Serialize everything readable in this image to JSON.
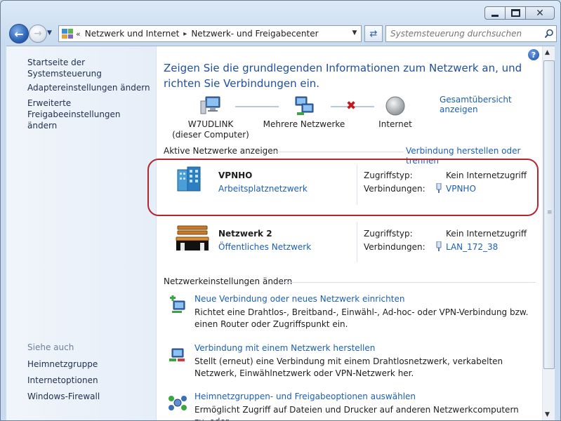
{
  "breadcrumb": {
    "chevrons": "«",
    "items": [
      "Netzwerk und Internet",
      "Netzwerk- und Freigabecenter"
    ]
  },
  "search": {
    "placeholder": "Systemsteuerung durchsuchen"
  },
  "sidebar": {
    "links": [
      "Startseite der Systemsteuerung",
      "Adaptereinstellungen ändern",
      "Erweiterte Freigabeeinstellungen ändern"
    ],
    "see_also_heading": "Siehe auch",
    "see_also": [
      "Heimnetzgruppe",
      "Internetoptionen",
      "Windows-Firewall"
    ]
  },
  "main": {
    "title": "Zeigen Sie die grundlegenden Informationen zum Netzwerk an, und richten Sie Verbindungen ein.",
    "overview_link": "Gesamtübersicht anzeigen",
    "map": {
      "computer_name": "W7UDLINK",
      "computer_sub": "(dieser Computer)",
      "networks_label": "Mehrere Netzwerke",
      "internet_label": "Internet"
    },
    "active_networks": {
      "heading": "Aktive Netzwerke anzeigen",
      "connect_link": "Verbindung herstellen oder trennen",
      "access_type_label": "Zugriffstyp:",
      "connections_label": "Verbindungen:",
      "networks": [
        {
          "name": "VPNHO",
          "category": "Arbeitsplatznetzwerk",
          "access_type": "Kein Internetzugriff",
          "connection": "VPNHO"
        },
        {
          "name": "Netzwerk  2",
          "category": "Öffentliches Netzwerk",
          "access_type": "Kein Internetzugriff",
          "connection": "LAN_172_38"
        }
      ]
    },
    "settings": {
      "heading": "Netzwerkeinstellungen ändern",
      "tasks": [
        {
          "link": "Neue Verbindung oder neues Netzwerk einrichten",
          "desc": "Richtet eine Drahtlos-, Breitband-, Einwähl-, Ad-hoc- oder VPN-Verbindung bzw. einen Router oder Zugriffspunkt ein."
        },
        {
          "link": "Verbindung mit einem Netzwerk herstellen",
          "desc": "Stellt (erneut) eine Verbindung mit einem Drahtlosnetzwerk, verkabelten Netzwerk, Einwählnetzwerk oder VPN-Netzwerk her."
        },
        {
          "link": "Heimnetzgruppen- und Freigabeoptionen auswählen",
          "desc": "Ermöglicht Zugriff auf Dateien und Drucker auf anderen Netzwerkcomputern zu, oder"
        }
      ]
    }
  },
  "colors": {
    "link": "#1b5fb4",
    "title": "#1e4fa0",
    "highlight": "#b3262f"
  }
}
